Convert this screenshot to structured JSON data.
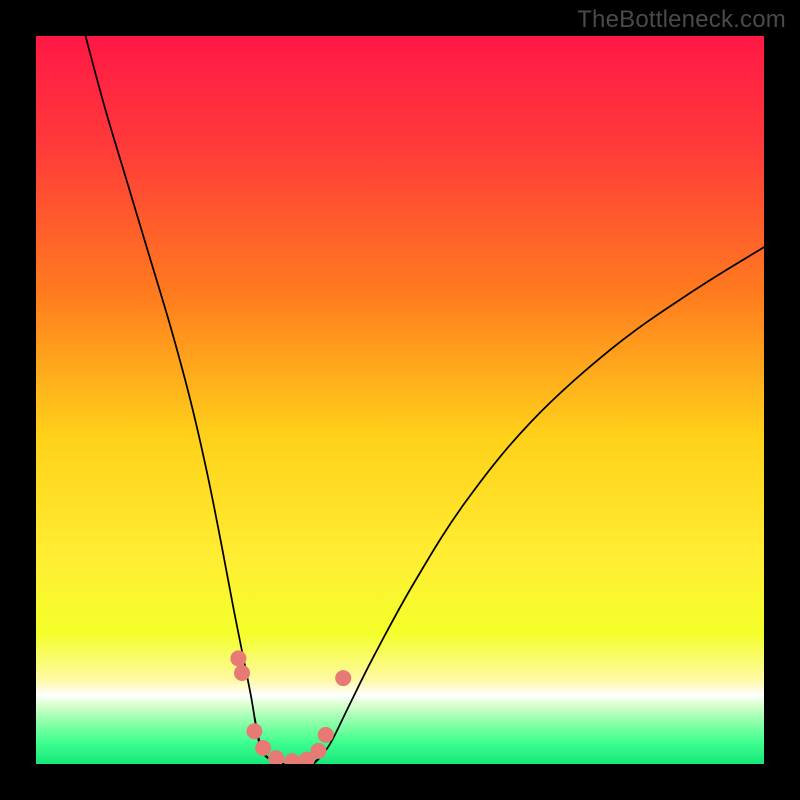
{
  "watermark": "TheBottleneck.com",
  "chart_data": {
    "type": "line",
    "title": "",
    "xlabel": "",
    "ylabel": "",
    "xlim": [
      0,
      1000
    ],
    "ylim": [
      0,
      1000
    ],
    "gradient_stops": [
      {
        "offset": 0.0,
        "color": "#ff1846"
      },
      {
        "offset": 0.15,
        "color": "#ff3a3a"
      },
      {
        "offset": 0.35,
        "color": "#ff7a1f"
      },
      {
        "offset": 0.55,
        "color": "#ffd11a"
      },
      {
        "offset": 0.72,
        "color": "#ffee33"
      },
      {
        "offset": 0.82,
        "color": "#f4ff2a"
      },
      {
        "offset": 0.885,
        "color": "#fff9a5"
      },
      {
        "offset": 0.905,
        "color": "#ffffff"
      },
      {
        "offset": 0.92,
        "color": "#d5ffcc"
      },
      {
        "offset": 0.945,
        "color": "#86ffa6"
      },
      {
        "offset": 0.97,
        "color": "#3fff8f"
      },
      {
        "offset": 1.0,
        "color": "#16e87a"
      }
    ],
    "series": [
      {
        "name": "curve-left",
        "type": "line",
        "x": [
          68,
          95,
          125,
          155,
          185,
          212,
          235,
          255,
          272,
          285,
          295,
          300,
          304,
          310,
          322,
          340
        ],
        "y": [
          1000,
          900,
          800,
          700,
          600,
          500,
          400,
          300,
          210,
          145,
          95,
          65,
          40,
          20,
          6,
          0
        ]
      },
      {
        "name": "curve-right",
        "type": "line",
        "x": [
          380,
          395,
          408,
          430,
          465,
          520,
          590,
          680,
          790,
          900,
          1000
        ],
        "y": [
          0,
          15,
          35,
          80,
          150,
          250,
          360,
          470,
          570,
          648,
          710
        ]
      },
      {
        "name": "valley-floor",
        "type": "line",
        "x": [
          300,
          310,
          322,
          340,
          360,
          380,
          395
        ],
        "y": [
          65,
          20,
          6,
          0,
          0,
          0,
          15
        ]
      }
    ],
    "markers": [
      {
        "x": 278,
        "y": 145,
        "r": 11
      },
      {
        "x": 283,
        "y": 125,
        "r": 11
      },
      {
        "x": 300,
        "y": 45,
        "r": 11
      },
      {
        "x": 312,
        "y": 22,
        "r": 11
      },
      {
        "x": 330,
        "y": 8,
        "r": 11
      },
      {
        "x": 352,
        "y": 4,
        "r": 11
      },
      {
        "x": 372,
        "y": 6,
        "r": 11
      },
      {
        "x": 388,
        "y": 18,
        "r": 11
      },
      {
        "x": 398,
        "y": 40,
        "r": 11
      },
      {
        "x": 422,
        "y": 118,
        "r": 11
      }
    ],
    "marker_style": {
      "fill": "#e77a75",
      "stroke": "#c9534c"
    }
  }
}
